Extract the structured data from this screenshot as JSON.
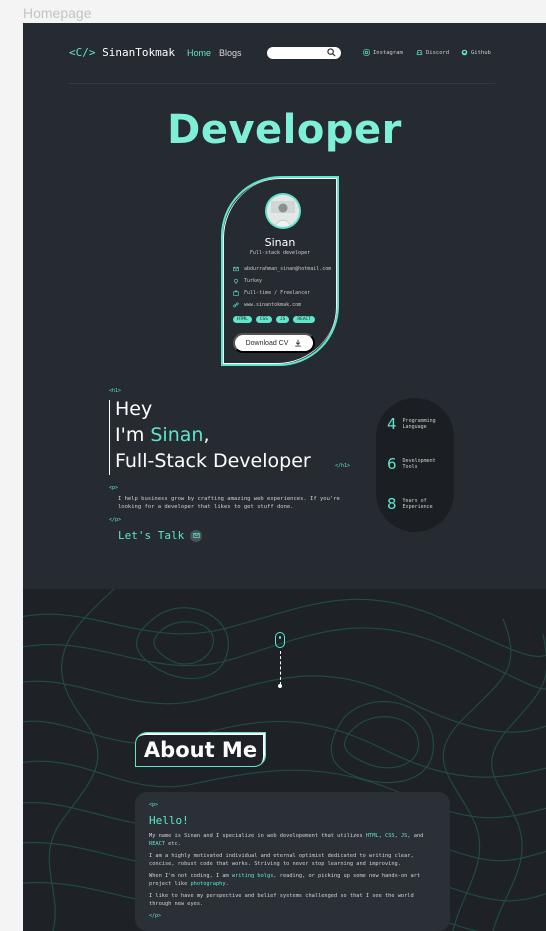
{
  "frame_label": "Homepage",
  "nav": {
    "logo_open": "<C/>",
    "logo_name": "SinanTokmak",
    "links": [
      "Home",
      "Blogs"
    ],
    "socials": [
      "Instagram",
      "Discord",
      "Github"
    ]
  },
  "hero": {
    "title": "Developer",
    "card": {
      "name": "Sinan",
      "role": "Full-stack developer",
      "email": "abdurrahman_sinan@hotmail.com",
      "location": "Turkey",
      "work": "Full-time / Freelancer",
      "website": "www.sinantokmak.com",
      "tags": [
        "HTML",
        "CSS",
        "JS",
        "REACT"
      ],
      "cv_label": "Download CV"
    },
    "h1_open": "<h1>",
    "h1_close": "</h1>",
    "hey": "Hey",
    "im": "I'm ",
    "name": "Sinan",
    "comma": ",",
    "role": "Full-Stack Developer",
    "p_open": "<p>",
    "p_close": "</p>",
    "description": "I help business grow by crafting amazing web experiences. If you're looking for a developer that likes to get stuff done.",
    "talk": "Let's Talk",
    "stats": [
      {
        "num": "4",
        "label": "Programming\nLanguage"
      },
      {
        "num": "6",
        "label": "Development\nTools"
      },
      {
        "num": "8",
        "label": "Years of\nExperience"
      }
    ]
  },
  "about": {
    "title": "About Me",
    "p_open": "<p>",
    "p_close": "</p>",
    "hello": "Hello!",
    "p1_a": "My name is Sinan and I specialize in web developement that utilizes ",
    "p1_html": "HTML",
    "p1_c1": ", ",
    "p1_css": "CSS",
    "p1_c2": ", ",
    "p1_js": "JS",
    "p1_c3": ", and ",
    "p1_react": "REACT",
    "p1_end": " etc.",
    "p2": "I am a highly motivated individual and eternal optimist dedicated to writing clear, concise, robust code that works. Striving to never stop learning and improving.",
    "p3_a": "When I'm not coding, I am ",
    "p3_blogs": "writing bolgs",
    "p3_b": ", reading, or picking up some new hands-on art project like ",
    "p3_photo": "photography",
    "p3_end": ".",
    "p4": "I like to have my perspective and belief systems challenged so that I see the world through new eyes."
  }
}
